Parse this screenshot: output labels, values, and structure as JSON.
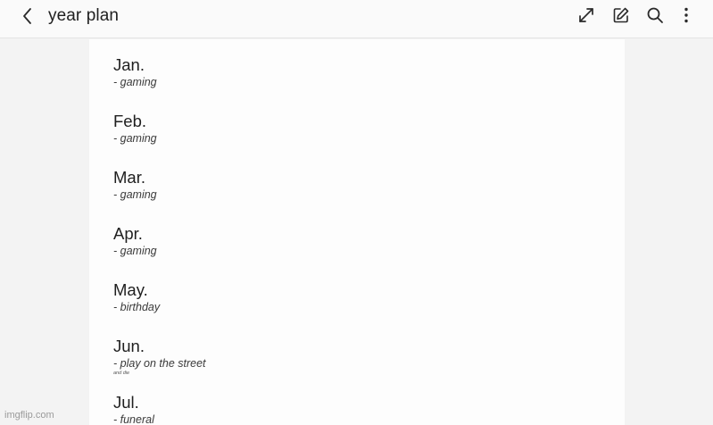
{
  "header": {
    "title": "year plan",
    "back_icon": "chevron-left-icon",
    "actions": [
      {
        "name": "expand",
        "icon": "expand-arrows-icon"
      },
      {
        "name": "edit",
        "icon": "pencil-square-icon"
      },
      {
        "name": "search",
        "icon": "search-icon"
      },
      {
        "name": "more",
        "icon": "more-vertical-icon"
      }
    ]
  },
  "note": {
    "months": [
      {
        "name": "Jan.",
        "entries": [
          "- gaming"
        ]
      },
      {
        "name": "Feb.",
        "entries": [
          "- gaming"
        ]
      },
      {
        "name": "Mar.",
        "entries": [
          "- gaming"
        ]
      },
      {
        "name": "Apr.",
        "entries": [
          "- gaming"
        ]
      },
      {
        "name": "May.",
        "entries": [
          "- birthday"
        ]
      },
      {
        "name": "Jun.",
        "entries": [
          "- play on the street"
        ],
        "tiny_note": "and die"
      },
      {
        "name": "Jul.",
        "entries": [
          "- funeral"
        ]
      }
    ]
  },
  "watermark": "imgflip.com",
  "colors": {
    "page_background": "#f3f3f3",
    "sheet_background": "#fdfdfd",
    "text": "#1f1f1f"
  }
}
